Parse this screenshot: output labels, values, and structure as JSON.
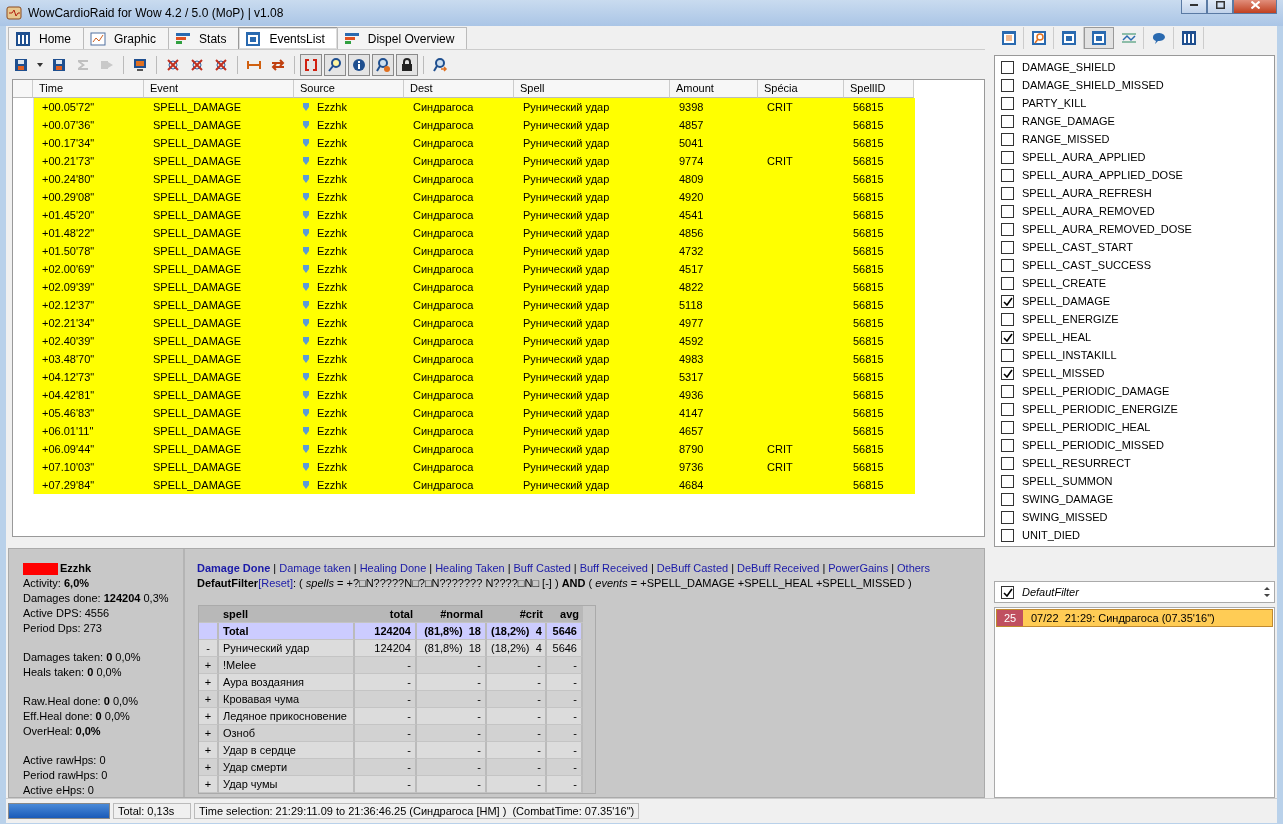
{
  "window": {
    "title": "WowCardioRaid for Wow 4.2 / 5.0 (MoP) | v1.08"
  },
  "tabs": [
    {
      "label": "Home",
      "selected": false
    },
    {
      "label": "Graphic",
      "selected": false
    },
    {
      "label": "Stats",
      "selected": false
    },
    {
      "label": "EventsList",
      "selected": true
    },
    {
      "label": "Dispel Overview",
      "selected": false
    }
  ],
  "toolbar": [
    {
      "pressed": false,
      "disabled": false
    },
    {
      "pressed": false,
      "disabled": false
    },
    {
      "pressed": false,
      "disabled": false
    },
    {
      "pressed": false,
      "disabled": true
    },
    {
      "pressed": false,
      "disabled": true
    },
    {
      "pressed": false,
      "disabled": false
    },
    {
      "pressed": false,
      "disabled": false
    },
    {
      "pressed": false,
      "disabled": false
    },
    {
      "pressed": false,
      "disabled": false
    },
    {
      "pressed": false,
      "disabled": false
    },
    {
      "pressed": false,
      "disabled": false
    },
    {
      "pressed": true,
      "disabled": false
    },
    {
      "pressed": true,
      "disabled": false
    },
    {
      "pressed": true,
      "disabled": false
    },
    {
      "pressed": true,
      "disabled": false
    },
    {
      "pressed": true,
      "disabled": false
    },
    {
      "pressed": false,
      "disabled": false
    }
  ],
  "events": {
    "columns": [
      "Time",
      "Event",
      "Source",
      "Dest",
      "Spell",
      "Amount",
      "Spécia",
      "SpellID"
    ],
    "rows": [
      {
        "time": "+00.05'72\"",
        "event": "SPELL_DAMAGE",
        "source": "Ezzhk",
        "dest": "Синдрагоса",
        "spell": "Рунический удар",
        "amount": "9398",
        "specia": "CRIT",
        "spell_id": "56815"
      },
      {
        "time": "+00.07'36\"",
        "event": "SPELL_DAMAGE",
        "source": "Ezzhk",
        "dest": "Синдрагоса",
        "spell": "Рунический удар",
        "amount": "4857",
        "specia": "",
        "spell_id": "56815"
      },
      {
        "time": "+00.17'34\"",
        "event": "SPELL_DAMAGE",
        "source": "Ezzhk",
        "dest": "Синдрагоса",
        "spell": "Рунический удар",
        "amount": "5041",
        "specia": "",
        "spell_id": "56815"
      },
      {
        "time": "+00.21'73\"",
        "event": "SPELL_DAMAGE",
        "source": "Ezzhk",
        "dest": "Синдрагоса",
        "spell": "Рунический удар",
        "amount": "9774",
        "specia": "CRIT",
        "spell_id": "56815"
      },
      {
        "time": "+00.24'80\"",
        "event": "SPELL_DAMAGE",
        "source": "Ezzhk",
        "dest": "Синдрагоса",
        "spell": "Рунический удар",
        "amount": "4809",
        "specia": "",
        "spell_id": "56815"
      },
      {
        "time": "+00.29'08\"",
        "event": "SPELL_DAMAGE",
        "source": "Ezzhk",
        "dest": "Синдрагоса",
        "spell": "Рунический удар",
        "amount": "4920",
        "specia": "",
        "spell_id": "56815"
      },
      {
        "time": "+01.45'20\"",
        "event": "SPELL_DAMAGE",
        "source": "Ezzhk",
        "dest": "Синдрагоса",
        "spell": "Рунический удар",
        "amount": "4541",
        "specia": "",
        "spell_id": "56815"
      },
      {
        "time": "+01.48'22\"",
        "event": "SPELL_DAMAGE",
        "source": "Ezzhk",
        "dest": "Синдрагоса",
        "spell": "Рунический удар",
        "amount": "4856",
        "specia": "",
        "spell_id": "56815"
      },
      {
        "time": "+01.50'78\"",
        "event": "SPELL_DAMAGE",
        "source": "Ezzhk",
        "dest": "Синдрагоса",
        "spell": "Рунический удар",
        "amount": "4732",
        "specia": "",
        "spell_id": "56815"
      },
      {
        "time": "+02.00'69\"",
        "event": "SPELL_DAMAGE",
        "source": "Ezzhk",
        "dest": "Синдрагоса",
        "spell": "Рунический удар",
        "amount": "4517",
        "specia": "",
        "spell_id": "56815"
      },
      {
        "time": "+02.09'39\"",
        "event": "SPELL_DAMAGE",
        "source": "Ezzhk",
        "dest": "Синдрагоса",
        "spell": "Рунический удар",
        "amount": "4822",
        "specia": "",
        "spell_id": "56815"
      },
      {
        "time": "+02.12'37\"",
        "event": "SPELL_DAMAGE",
        "source": "Ezzhk",
        "dest": "Синдрагоса",
        "spell": "Рунический удар",
        "amount": "5118",
        "specia": "",
        "spell_id": "56815"
      },
      {
        "time": "+02.21'34\"",
        "event": "SPELL_DAMAGE",
        "source": "Ezzhk",
        "dest": "Синдрагоса",
        "spell": "Рунический удар",
        "amount": "4977",
        "specia": "",
        "spell_id": "56815"
      },
      {
        "time": "+02.40'39\"",
        "event": "SPELL_DAMAGE",
        "source": "Ezzhk",
        "dest": "Синдрагоса",
        "spell": "Рунический удар",
        "amount": "4592",
        "specia": "",
        "spell_id": "56815"
      },
      {
        "time": "+03.48'70\"",
        "event": "SPELL_DAMAGE",
        "source": "Ezzhk",
        "dest": "Синдрагоса",
        "spell": "Рунический удар",
        "amount": "4983",
        "specia": "",
        "spell_id": "56815"
      },
      {
        "time": "+04.12'73\"",
        "event": "SPELL_DAMAGE",
        "source": "Ezzhk",
        "dest": "Синдрагоса",
        "spell": "Рунический удар",
        "amount": "5317",
        "specia": "",
        "spell_id": "56815"
      },
      {
        "time": "+04.42'81\"",
        "event": "SPELL_DAMAGE",
        "source": "Ezzhk",
        "dest": "Синдрагоса",
        "spell": "Рунический удар",
        "amount": "4936",
        "specia": "",
        "spell_id": "56815"
      },
      {
        "time": "+05.46'83\"",
        "event": "SPELL_DAMAGE",
        "source": "Ezzhk",
        "dest": "Синдрагоса",
        "spell": "Рунический удар",
        "amount": "4147",
        "specia": "",
        "spell_id": "56815"
      },
      {
        "time": "+06.01'11\"",
        "event": "SPELL_DAMAGE",
        "source": "Ezzhk",
        "dest": "Синдрагоса",
        "spell": "Рунический удар",
        "amount": "4657",
        "specia": "",
        "spell_id": "56815"
      },
      {
        "time": "+06.09'44\"",
        "event": "SPELL_DAMAGE",
        "source": "Ezzhk",
        "dest": "Синдрагоса",
        "spell": "Рунический удар",
        "amount": "8790",
        "specia": "CRIT",
        "spell_id": "56815"
      },
      {
        "time": "+07.10'03\"",
        "event": "SPELL_DAMAGE",
        "source": "Ezzhk",
        "dest": "Синдрагоса",
        "spell": "Рунический удар",
        "amount": "9736",
        "specia": "CRIT",
        "spell_id": "56815"
      },
      {
        "time": "+07.29'84\"",
        "event": "SPELL_DAMAGE",
        "source": "Ezzhk",
        "dest": "Синдрагоса",
        "spell": "Рунический удар",
        "amount": "4684",
        "specia": "",
        "spell_id": "56815"
      }
    ]
  },
  "player": {
    "name": "Ezzhk",
    "color": "#ff0000"
  },
  "stats": [
    [
      "Activity: **6,0%**",
      "Damages done: **124204** 0,3%",
      "Active DPS: 4556",
      "Period Dps: 273"
    ],
    [
      "Damages taken: **0** 0,0%",
      "Heals taken: **0** 0,0%"
    ],
    [
      "Raw.Heal done: **0** 0,0%",
      "Eff.Heal done: **0** 0,0%",
      "OverHeal: **0,0%**"
    ],
    [
      "Active rawHps: 0",
      "Period rawHps: 0",
      "Active eHps: 0"
    ]
  ],
  "report": {
    "links": [
      {
        "label": "Damage Done",
        "selected": true
      },
      {
        "label": "Damage taken",
        "selected": false
      },
      {
        "label": "Healing Done",
        "selected": false
      },
      {
        "label": "Healing Taken",
        "selected": false
      },
      {
        "label": "Buff Casted",
        "selected": false
      },
      {
        "label": "Buff Received",
        "selected": false
      },
      {
        "label": "DeBuff Casted",
        "selected": false
      },
      {
        "label": "DeBuff Received",
        "selected": false
      },
      {
        "label": "PowerGains",
        "selected": false
      },
      {
        "label": "Others",
        "selected": false
      }
    ],
    "separator": "|",
    "filter": {
      "name": "DefautFilter",
      "reset": "[Reset]",
      "expression": ": ( *spells* = +?□N?????N□?□N??????? N????□N□ [-] ) **AND** ( *events* = +SPELL_DAMAGE +SPELL_HEAL +SPELL_MISSED )"
    },
    "table": {
      "columns": [
        "spell",
        "total",
        "#normal",
        "#crit",
        "avg"
      ],
      "rows": [
        {
          "kind": "total",
          "expander": "",
          "spell": "Total",
          "total": "124204",
          "normal": "(81,8%)  18",
          "crit": "(18,2%)  4",
          "avg": "5646"
        },
        {
          "kind": "spell",
          "expander": "-",
          "spell": "Рунический удар",
          "total": "124204",
          "normal": "(81,8%)  18",
          "crit": "(18,2%)  4",
          "avg": "5646"
        },
        {
          "kind": "spell",
          "expander": "+",
          "spell": "!Melee",
          "total": "-",
          "normal": "-",
          "crit": "-",
          "avg": "-"
        },
        {
          "kind": "spell",
          "expander": "+",
          "spell": "Аура воздаяния",
          "total": "-",
          "normal": "-",
          "crit": "-",
          "avg": "-"
        },
        {
          "kind": "spell",
          "expander": "+",
          "spell": "Кровавая чума",
          "total": "-",
          "normal": "-",
          "crit": "-",
          "avg": "-"
        },
        {
          "kind": "spell",
          "expander": "+",
          "spell": "Ледяное прикосновение",
          "total": "-",
          "normal": "-",
          "crit": "-",
          "avg": "-"
        },
        {
          "kind": "spell",
          "expander": "+",
          "spell": "Озноб",
          "total": "-",
          "normal": "-",
          "crit": "-",
          "avg": "-"
        },
        {
          "kind": "spell",
          "expander": "+",
          "spell": "Удар в сердце",
          "total": "-",
          "normal": "-",
          "crit": "-",
          "avg": "-"
        },
        {
          "kind": "spell",
          "expander": "+",
          "spell": "Удар смерти",
          "total": "-",
          "normal": "-",
          "crit": "-",
          "avg": "-"
        },
        {
          "kind": "spell",
          "expander": "+",
          "spell": "Удар чумы",
          "total": "-",
          "normal": "-",
          "crit": "-",
          "avg": "-"
        }
      ]
    }
  },
  "view_buttons": [
    {
      "selected": false
    },
    {
      "selected": false
    },
    {
      "selected": false
    },
    {
      "selected": true
    },
    {
      "selected": false
    },
    {
      "selected": false
    },
    {
      "selected": false
    }
  ],
  "event_types": [
    {
      "label": "DAMAGE_SHIELD",
      "checked": false
    },
    {
      "label": "DAMAGE_SHIELD_MISSED",
      "checked": false
    },
    {
      "label": "PARTY_KILL",
      "checked": false
    },
    {
      "label": "RANGE_DAMAGE",
      "checked": false
    },
    {
      "label": "RANGE_MISSED",
      "checked": false
    },
    {
      "label": "SPELL_AURA_APPLIED",
      "checked": false
    },
    {
      "label": "SPELL_AURA_APPLIED_DOSE",
      "checked": false
    },
    {
      "label": "SPELL_AURA_REFRESH",
      "checked": false
    },
    {
      "label": "SPELL_AURA_REMOVED",
      "checked": false
    },
    {
      "label": "SPELL_AURA_REMOVED_DOSE",
      "checked": false
    },
    {
      "label": "SPELL_CAST_START",
      "checked": false
    },
    {
      "label": "SPELL_CAST_SUCCESS",
      "checked": false
    },
    {
      "label": "SPELL_CREATE",
      "checked": false
    },
    {
      "label": "SPELL_DAMAGE",
      "checked": true
    },
    {
      "label": "SPELL_ENERGIZE",
      "checked": false
    },
    {
      "label": "SPELL_HEAL",
      "checked": true
    },
    {
      "label": "SPELL_INSTAKILL",
      "checked": false
    },
    {
      "label": "SPELL_MISSED",
      "checked": true
    },
    {
      "label": "SPELL_PERIODIC_DAMAGE",
      "checked": false
    },
    {
      "label": "SPELL_PERIODIC_ENERGIZE",
      "checked": false
    },
    {
      "label": "SPELL_PERIODIC_HEAL",
      "checked": false
    },
    {
      "label": "SPELL_PERIODIC_MISSED",
      "checked": false
    },
    {
      "label": "SPELL_RESURRECT",
      "checked": false
    },
    {
      "label": "SPELL_SUMMON",
      "checked": false
    },
    {
      "label": "SWING_DAMAGE",
      "checked": false
    },
    {
      "label": "SWING_MISSED",
      "checked": false
    },
    {
      "label": "UNIT_DIED",
      "checked": false
    }
  ],
  "session_filter": {
    "label": "DefautFilter",
    "checked": true
  },
  "sessions": [
    {
      "badge": "25",
      "label": "07/22  21:29: Синдрагоса (07.35'16\")",
      "selected": true
    }
  ],
  "status_bar": {
    "level": 1,
    "total": "Total: 0,13s",
    "selection": "Time selection: 21:29:11.09 to 21:36:46.25 (Синдрагоса [HM] )  (CombatTime: 07.35'16\")"
  }
}
